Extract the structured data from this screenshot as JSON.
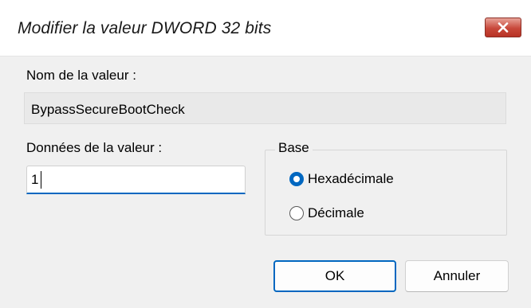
{
  "window": {
    "title": "Modifier la valeur DWORD 32 bits",
    "close_icon": "close-icon",
    "close_color": "#c8483a"
  },
  "value_name": {
    "label": "Nom de la valeur :",
    "value": "BypassSecureBootCheck"
  },
  "value_data": {
    "label": "Données de la valeur :",
    "value": "1"
  },
  "base": {
    "legend": "Base",
    "options": [
      {
        "label": "Hexadécimale",
        "checked": true
      },
      {
        "label": "Décimale",
        "checked": false
      }
    ]
  },
  "buttons": {
    "ok": "OK",
    "cancel": "Annuler"
  },
  "colors": {
    "accent": "#0067c0"
  }
}
